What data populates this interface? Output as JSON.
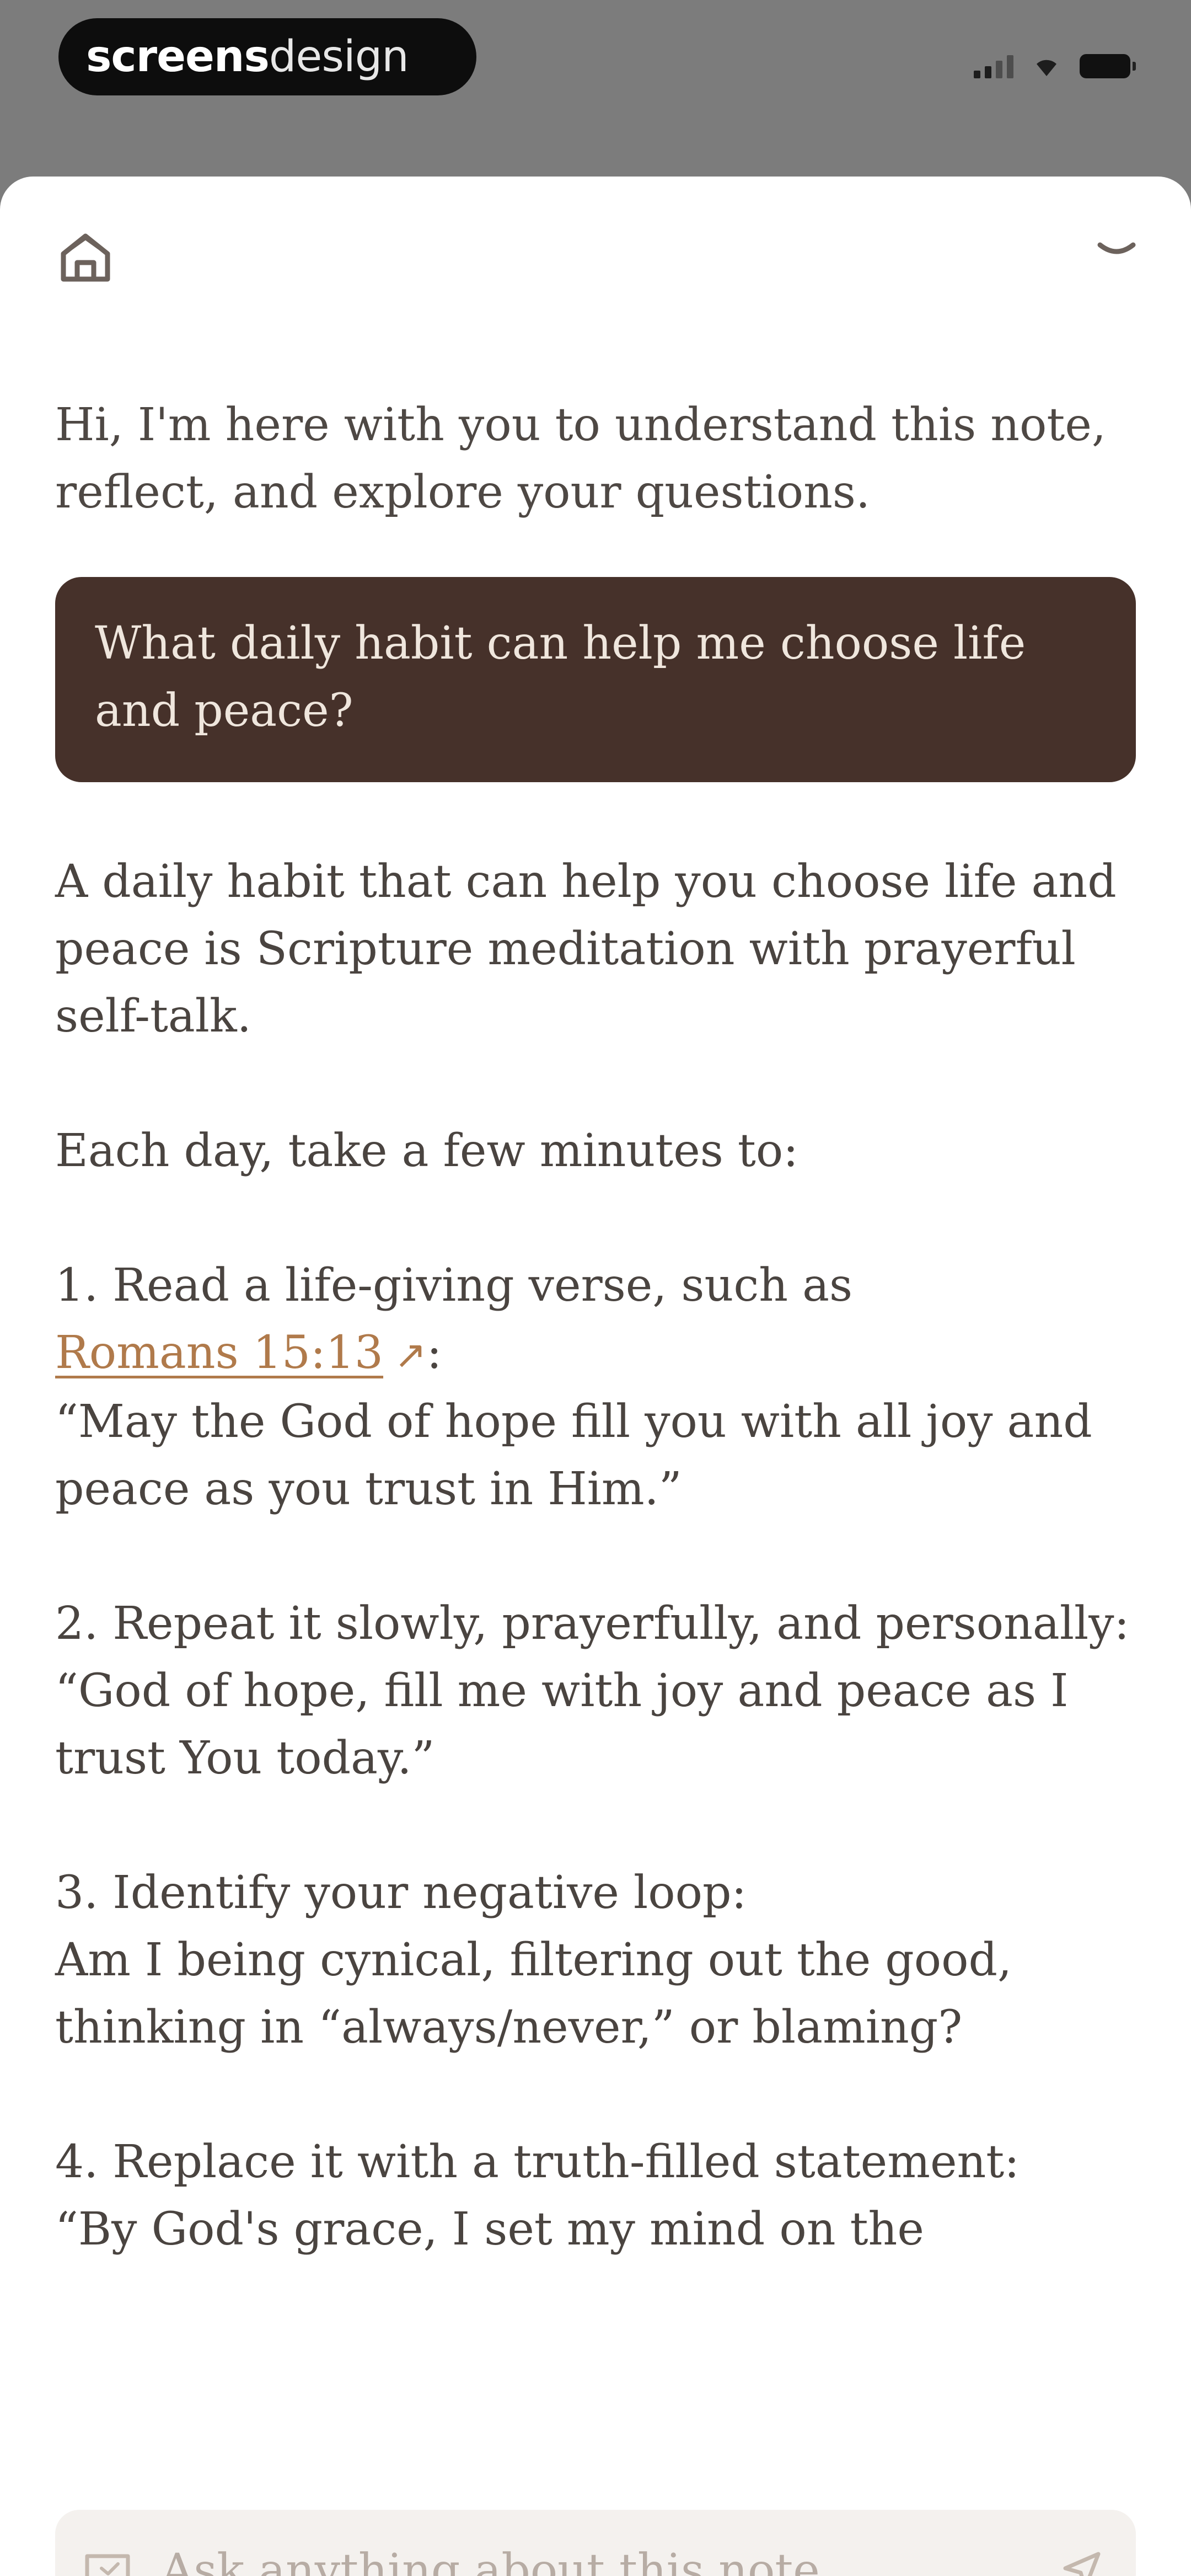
{
  "status_bar": {
    "watermark_bold": "screens",
    "watermark_light": "design"
  },
  "icons": {
    "home": "home-icon",
    "collapse": "chevron-down-icon",
    "chat": "chat-icon",
    "send": "send-icon",
    "link": "external-link-icon"
  },
  "chat": {
    "intro": "Hi, I'm here with you to understand this note, reflect, and explore your questions.",
    "user_message": "What daily habit can help me choose life and peace?",
    "answer": {
      "p1": "A daily habit that can help you choose life and peace is Scripture meditation with prayerful self-talk.",
      "p2": "Each day, take a few minutes to:",
      "step1_title": "1. Read a life-giving verse, such as",
      "step1_link": "Romans 15:13",
      "step1_link_suffix": ":",
      "step1_quote": "“May the God of hope fill you with all joy and peace as you trust in Him.”",
      "step2_title": "2. Repeat it slowly, prayerfully, and personally:",
      "step2_quote": "“God of hope, fill me with joy and peace as I trust You today.”",
      "step3_title": "3. Identify your negative loop:",
      "step3_text": "Am I being cynical, filtering out the good, thinking in “always/never,” or blaming?",
      "step4_title": "4. Replace it with a truth-filled statement:",
      "step4_text": "“By God's grace, I set my mind on the"
    }
  },
  "input": {
    "placeholder": "Ask anything about this note..."
  },
  "colors": {
    "backdrop": "#7c7c7c",
    "bubble": "#46312a",
    "link": "#b07a4b",
    "text": "#4a4440"
  }
}
